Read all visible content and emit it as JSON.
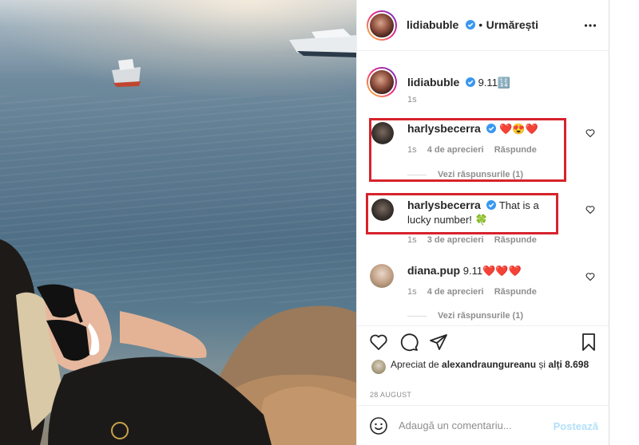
{
  "header": {
    "username": "lidiabuble",
    "dot": "•",
    "follow_label": "Urmărești"
  },
  "caption": {
    "username": "lidiabuble",
    "text": "9.11🔢",
    "time": "1s"
  },
  "comments": [
    {
      "username": "harlysbecerra",
      "text": "❤️😍❤️",
      "time": "1s",
      "likes": "4 de aprecieri",
      "reply": "Răspunde",
      "view_replies": "Vezi răspunsurile (1)"
    },
    {
      "username": "harlysbecerra",
      "text": "That is a lucky number! 🍀",
      "time": "1s",
      "likes": "3 de aprecieri",
      "reply": "Răspunde"
    },
    {
      "username": "diana.pup",
      "text": "9.11❤️❤️❤️",
      "time": "1s",
      "likes": "4 de aprecieri",
      "reply": "Răspunde",
      "view_replies": "Vezi răspunsurile (1)"
    }
  ],
  "liked_by": {
    "prefix": "Apreciat de",
    "user": "alexandraungureanu",
    "suffix": "și",
    "others": "alți 8.698"
  },
  "date": "28 AUGUST",
  "add_comment": {
    "placeholder": "Adaugă un comentariu...",
    "post_label": "Postează"
  },
  "icons": {
    "verified": "verified-badge-icon",
    "more": "more-options-icon",
    "like": "heart-icon",
    "comment": "comment-icon",
    "share": "paper-plane-icon",
    "save": "bookmark-icon",
    "emoji": "smiley-icon"
  },
  "colors": {
    "verified": "#3897f0",
    "highlight": "#d7232c",
    "post_disabled": "#b2dffc",
    "secondary_text": "#8e8e8e"
  }
}
